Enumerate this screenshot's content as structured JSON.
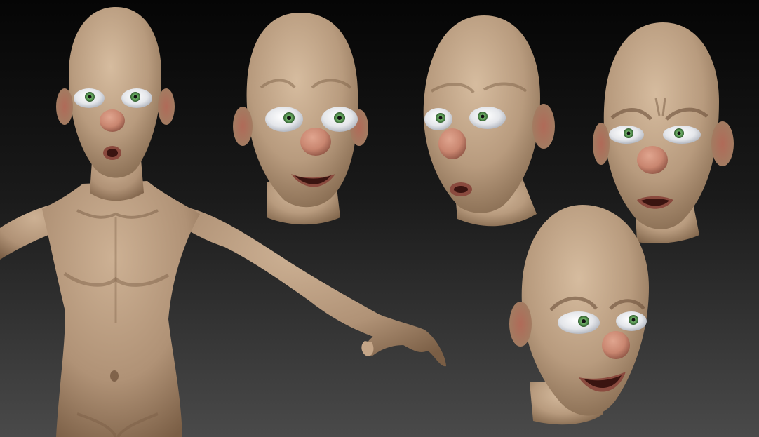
{
  "scene": {
    "colors": {
      "background_top": "#050505",
      "background_bottom": "#4a4a4a",
      "skin": "#b89b7e",
      "skin_shadow": "#7d6248",
      "nose": "#c98670",
      "lips": "#8a4a3e",
      "mouth_inside": "#3a1410",
      "eye_white": "#e4e6ea",
      "iris": "#5fa05a",
      "pupil": "#111111"
    },
    "subjects": [
      {
        "name": "full-body-figure"
      },
      {
        "name": "head-surprised"
      },
      {
        "name": "head-skeptical"
      },
      {
        "name": "head-frowning"
      },
      {
        "name": "head-sneering"
      }
    ]
  }
}
